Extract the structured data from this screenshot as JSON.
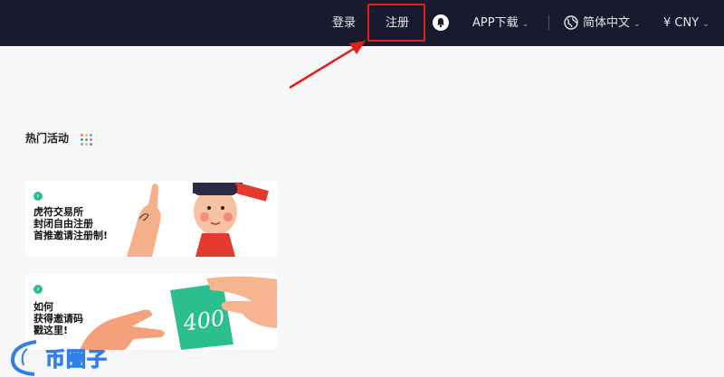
{
  "header": {
    "login_label": "登录",
    "register_label": "注册",
    "app_download_label": "APP下载",
    "language_label": "简体中文",
    "currency_label": "¥ CNY"
  },
  "main": {
    "section_title": "热门活动",
    "cards": [
      {
        "lines": [
          "虎符交易所",
          "封闭自由注册",
          "首推邀请注册制!"
        ]
      },
      {
        "lines": [
          "如何",
          "获得邀请码",
          "戳这里!"
        ]
      }
    ]
  },
  "watermark": {
    "text": "币圈子"
  },
  "colors": {
    "topbar": "#1a1a2e",
    "highlight": "#e0201b",
    "accent_green": "#2bbf8f",
    "page_bg": "#f7f7f9"
  }
}
